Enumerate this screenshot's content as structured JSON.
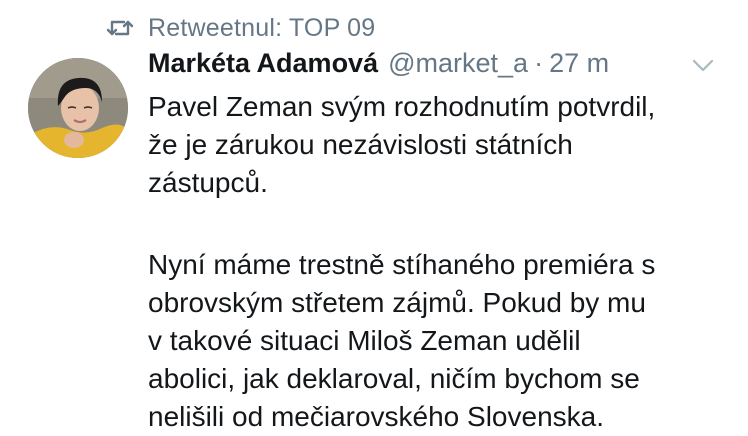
{
  "retweet": {
    "icon": "retweet-icon",
    "label": "Retweetnul: TOP 09"
  },
  "author": {
    "avatar_icon": "avatar-photo",
    "name": "Markéta Adamová",
    "handle": "@market_a",
    "separator": "·",
    "time": "27 m"
  },
  "menu": {
    "icon": "chevron-down-icon"
  },
  "text": {
    "paragraph1": [
      "Pavel Zeman svým rozhodnutím potvrdil,",
      "že je zárukou nezávislosti státních",
      "zástupců."
    ],
    "paragraph2": [
      "Nyní máme trestně stíhaného premiéra s",
      "obrovským střetem zájmů. Pokud by mu",
      "v takové situaci Miloš Zeman udělil",
      "abolici, jak deklaroval, ničím bychom se",
      "nelišili od mečiarovského Slovenska."
    ]
  },
  "colors": {
    "text": "#14171a",
    "secondary": "#657786",
    "background": "#ffffff"
  }
}
